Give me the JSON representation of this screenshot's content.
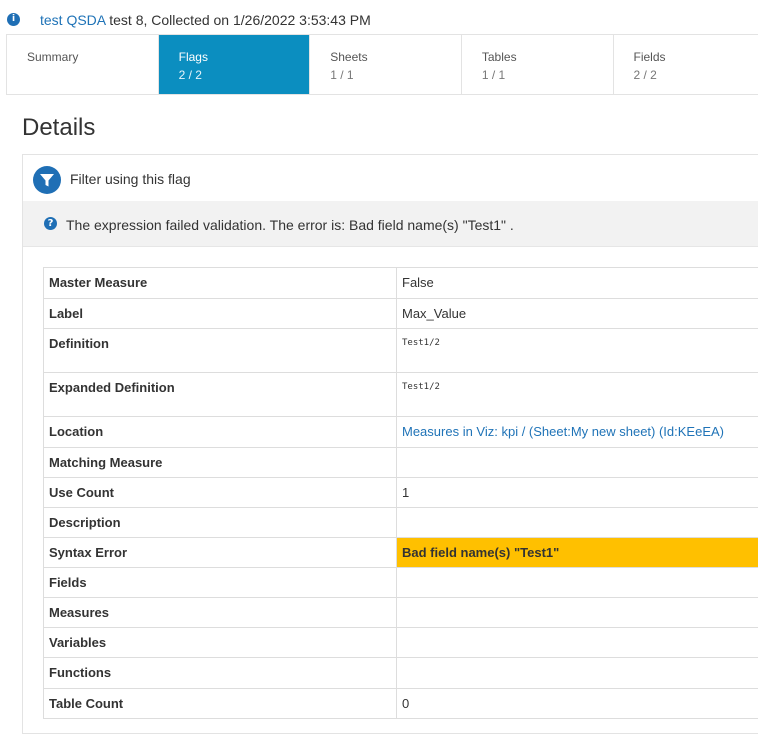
{
  "header": {
    "info_icon": "info-icon",
    "link_text": "test QSDA",
    "rest_text": " test 8, Collected on 1/26/2022 3:53:43 PM"
  },
  "tabs": [
    {
      "label": "Summary",
      "count": ""
    },
    {
      "label": "Flags",
      "count": "2 / 2"
    },
    {
      "label": "Sheets",
      "count": "1 / 1"
    },
    {
      "label": "Tables",
      "count": "1 / 1"
    },
    {
      "label": "Fields",
      "count": "2 / 2"
    }
  ],
  "active_tab": "Flags",
  "details": {
    "heading": "Details",
    "flag_title": "Filter using this flag",
    "flag_icon": "filter-icon",
    "help_icon": "question-icon",
    "error_message": "The expression failed validation. The error is: Bad field name(s) \"Test1\" ."
  },
  "properties": [
    {
      "key": "Master Measure",
      "value": "False"
    },
    {
      "key": "Label",
      "value": "Max_Value"
    },
    {
      "key": "Definition",
      "value": "Test1/2"
    },
    {
      "key": "Expanded Definition",
      "value": "Test1/2"
    },
    {
      "key": "Location",
      "value": "Measures in Viz: kpi / (Sheet:My new sheet) (Id:KEeEA)"
    },
    {
      "key": "Matching Measure",
      "value": ""
    },
    {
      "key": "Use Count",
      "value": "1"
    },
    {
      "key": "Description",
      "value": ""
    },
    {
      "key": "Syntax Error",
      "value": "Bad field name(s) \"Test1\""
    },
    {
      "key": "Fields",
      "value": ""
    },
    {
      "key": "Measures",
      "value": ""
    },
    {
      "key": "Variables",
      "value": ""
    },
    {
      "key": "Functions",
      "value": ""
    },
    {
      "key": "Table Count",
      "value": "0"
    }
  ],
  "colors": {
    "accent": "#0b8ec0",
    "link": "#1f73b7",
    "error_highlight": "#ffc000",
    "icon_blue": "#1f6fb5"
  }
}
